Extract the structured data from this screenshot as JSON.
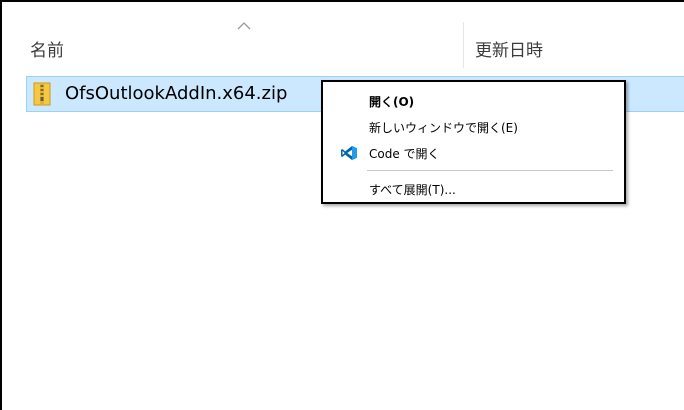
{
  "header": {
    "name_label": "名前",
    "date_label": "更新日時",
    "sort_indicator": "^"
  },
  "files": [
    {
      "name": "OfsOutlookAddIn.x64.zip",
      "icon": "zip-folder-icon"
    }
  ],
  "context_menu": {
    "items": [
      {
        "label": "開く(O)",
        "bold": true
      },
      {
        "label": "新しいウィンドウで開く(E)",
        "bold": false
      },
      {
        "label": "Code で開く",
        "bold": false,
        "icon": "vscode-icon"
      },
      {
        "label": "すべて展開(T)...",
        "bold": false
      }
    ]
  },
  "colors": {
    "selection_bg": "#cce8ff",
    "selection_border": "#99d1ff",
    "vscode_blue": "#0065a9"
  }
}
